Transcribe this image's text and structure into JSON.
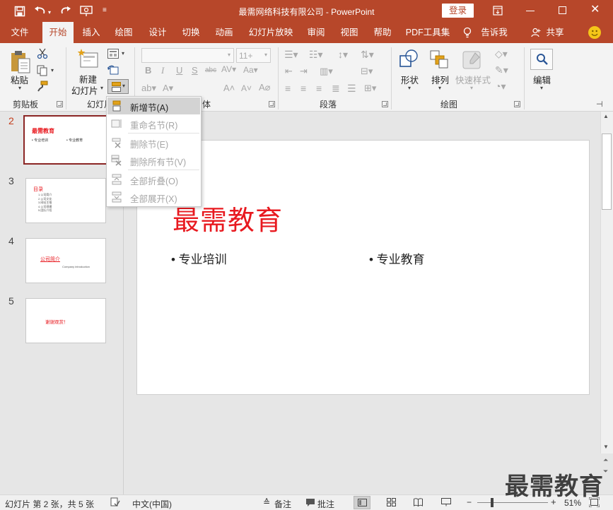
{
  "title_bar": {
    "title": "最需网络科技有限公司  -  PowerPoint",
    "login": "登录"
  },
  "tabs": [
    "文件",
    "开始",
    "插入",
    "绘图",
    "设计",
    "切换",
    "动画",
    "幻灯片放映",
    "审阅",
    "视图",
    "帮助",
    "PDF工具集",
    "告诉我",
    "共享"
  ],
  "ribbon": {
    "clipboard": {
      "paste": "粘贴",
      "group": "剪贴板"
    },
    "slides": {
      "new_line1": "新建",
      "new_line2": "幻灯片",
      "group": "幻灯片"
    },
    "font": {
      "size": "11+",
      "group_tail": "体"
    },
    "paragraph": {
      "group": "段落"
    },
    "drawing": {
      "shapes": "形状",
      "arrange": "排列",
      "quick_styles": "快速样式",
      "group": "绘图"
    },
    "editing": {
      "edit": "编辑"
    }
  },
  "section_menu": [
    {
      "label": "新增节(A)",
      "enabled": true
    },
    {
      "label": "重命名节(R)",
      "enabled": false
    },
    {
      "label": "删除节(E)",
      "enabled": false
    },
    {
      "label": "删除所有节(V)",
      "enabled": false
    },
    {
      "label": "全部折叠(O)",
      "enabled": false
    },
    {
      "label": "全部展开(X)",
      "enabled": false
    }
  ],
  "thumbnails": [
    {
      "num": "2",
      "title": "最需教育",
      "b1": "• 专业培训",
      "b2": "• 专业教育"
    },
    {
      "num": "3",
      "title": "目录",
      "lines": [
        "1.公司简介",
        "2.公司文化",
        "3.网站主推",
        "4.公司规模",
        "5.团队介绍"
      ]
    },
    {
      "num": "4",
      "title": "公司简介",
      "sub": "Company  introduction"
    },
    {
      "num": "5",
      "text": "谢谢观赏！"
    }
  ],
  "slide": {
    "title": "最需教育",
    "bullet1": "• 专业培训",
    "bullet2": "• 专业教育"
  },
  "status": {
    "slide_info": "幻灯片 第 2 张，共 5 张",
    "language": "中文(中国)",
    "notes": "备注",
    "comments": "批注",
    "zoom": "51%"
  },
  "watermark": "最需教育",
  "colors": {
    "accent": "#b7472a",
    "slide_title": "#e8191f",
    "selected_border": "#8b2524"
  }
}
